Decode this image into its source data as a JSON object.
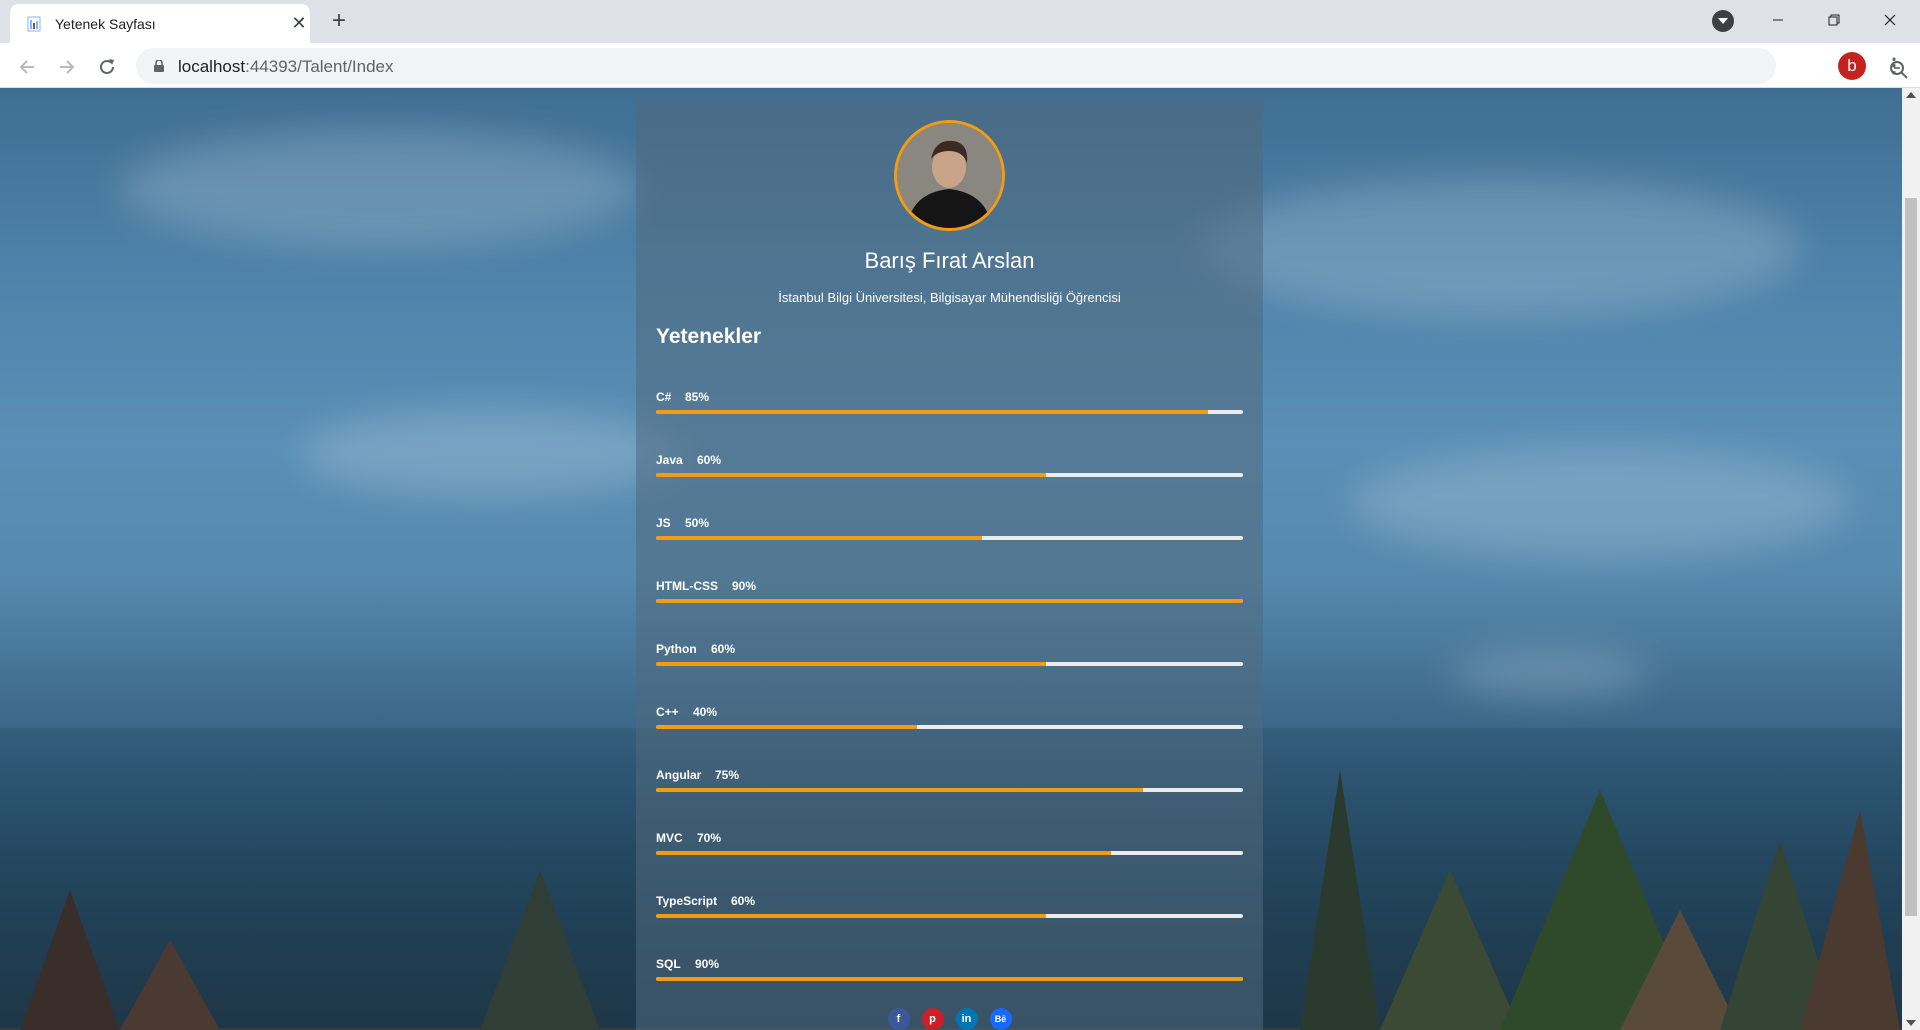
{
  "browser": {
    "tab_title": "Yetenek Sayfası",
    "close_glyph": "✕",
    "newtab_glyph": "+",
    "url_host": "localhost",
    "url_rest": ":44393/Talent/Index",
    "profile_initial": "b",
    "icons": [
      "page-icon",
      "close-icon",
      "plus-icon",
      "tab-search-icon",
      "minimize-icon",
      "maximize-icon",
      "close-window-icon",
      "back-icon",
      "forward-icon",
      "reload-icon",
      "lock-icon",
      "zoom-icon",
      "star-icon",
      "menu-icon"
    ]
  },
  "profile": {
    "name": "Barış Fırat Arslan",
    "subtitle": "İstanbul Bilgi Üniversitesi, Bilgisayar Mühendisliği Öğrencisi"
  },
  "skills_section": {
    "title": "Yetenekler",
    "accent_color": "#f39c12",
    "track_color": "#ececec",
    "items": [
      {
        "name": "C#",
        "percent_label": "85%",
        "fill_fraction": 0.94
      },
      {
        "name": "Java",
        "percent_label": "60%",
        "fill_fraction": 0.665
      },
      {
        "name": "JS",
        "percent_label": "50%",
        "fill_fraction": 0.555
      },
      {
        "name": "HTML-CSS",
        "percent_label": "90%",
        "fill_fraction": 1.0
      },
      {
        "name": "Python",
        "percent_label": "60%",
        "fill_fraction": 0.665
      },
      {
        "name": "C++",
        "percent_label": "40%",
        "fill_fraction": 0.445
      },
      {
        "name": "Angular",
        "percent_label": "75%",
        "fill_fraction": 0.83
      },
      {
        "name": "MVC",
        "percent_label": "70%",
        "fill_fraction": 0.775
      },
      {
        "name": "TypeScript",
        "percent_label": "60%",
        "fill_fraction": 0.665
      },
      {
        "name": "SQL",
        "percent_label": "90%",
        "fill_fraction": 1.0
      }
    ]
  },
  "socials": [
    {
      "label": "f",
      "icon": "facebook-icon"
    },
    {
      "label": "p",
      "icon": "pinterest-icon"
    },
    {
      "label": "in",
      "icon": "linkedin-icon"
    },
    {
      "label": "Bē",
      "icon": "behance-icon"
    }
  ]
}
